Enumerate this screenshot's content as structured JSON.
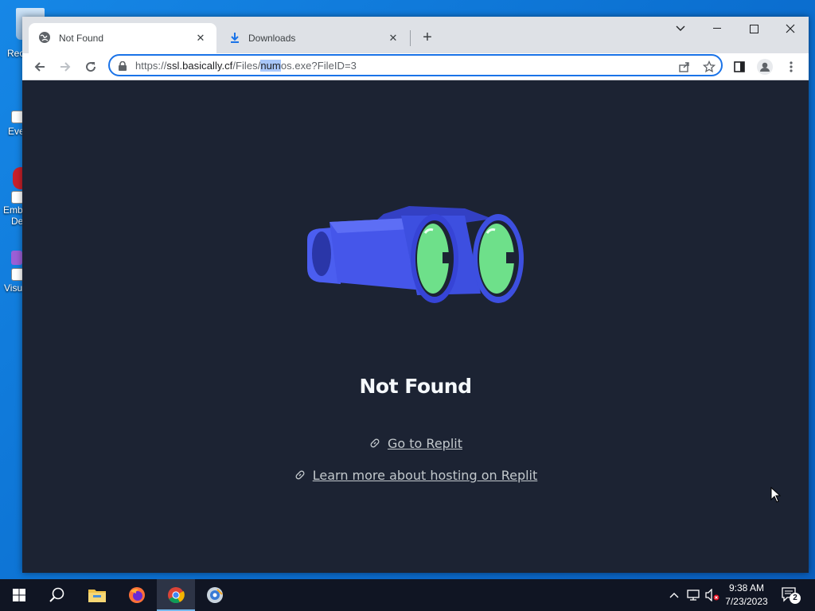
{
  "desktop": {
    "icons": [
      {
        "label": "Rec"
      },
      {
        "label": "Eve"
      },
      {
        "label": "Emb"
      },
      {
        "label": "De"
      },
      {
        "label": "Visu"
      }
    ]
  },
  "browser": {
    "tabs": [
      {
        "title": "Not Found",
        "icon": "globe-icon",
        "active": true
      },
      {
        "title": "Downloads",
        "icon": "download-icon",
        "active": false
      }
    ],
    "new_tab_label": "+",
    "address": {
      "scheme": "https://",
      "host": "ssl.basically.cf",
      "path_before": "/Files/",
      "path_selected": "num",
      "path_after": "os.exe?FileID=3"
    }
  },
  "page": {
    "heading": "Not Found",
    "links": [
      {
        "label": "Go to Replit"
      },
      {
        "label": "Learn more about hosting on Replit"
      }
    ]
  },
  "taskbar": {
    "apps": [
      "start-icon",
      "search-icon",
      "file-explorer-icon",
      "firefox-icon",
      "chrome-icon",
      "media-app-icon"
    ],
    "active_app": "chrome-icon",
    "clock_time": "9:38 AM",
    "clock_date": "7/23/2023",
    "notification_count": "2"
  },
  "colors": {
    "page_background": "#1c2333",
    "binocular_body": "#3d4fe0",
    "lens": "#6ee08a",
    "accent": "#1a73e8"
  }
}
